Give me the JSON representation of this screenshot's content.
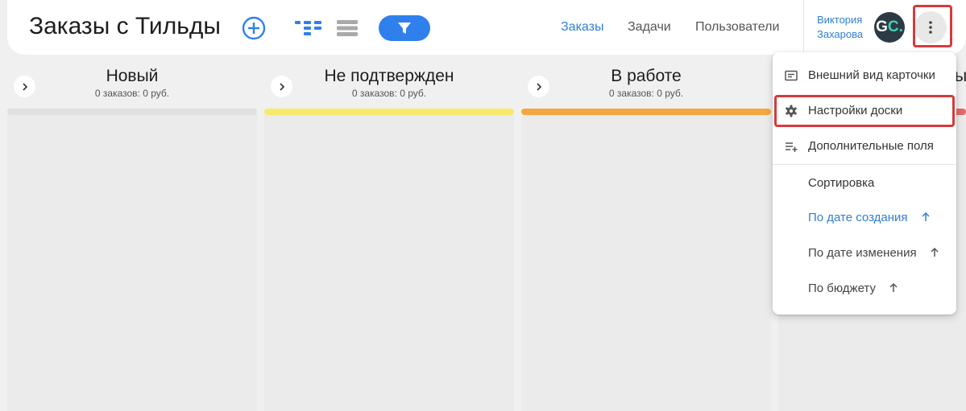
{
  "header": {
    "title": "Заказы с Тильды",
    "nav": [
      {
        "label": "Заказы",
        "active": true
      },
      {
        "label": "Задачи",
        "active": false
      },
      {
        "label": "Пользователи",
        "active": false
      }
    ],
    "user": {
      "first_name": "Виктория",
      "last_name": "Захарова",
      "avatar_initials_main": "G",
      "avatar_initials_accent": "C."
    },
    "icons": {
      "add": "plus-circle-icon",
      "kanban": "kanban-view-icon",
      "list": "list-view-icon",
      "filter": "filter-icon",
      "more": "more-vertical-icon"
    }
  },
  "columns": [
    {
      "title": "Новый",
      "summary": "0 заказов: 0 руб.",
      "color": "#e0e0e0"
    },
    {
      "title": "Не подтвержден",
      "summary": "0 заказов: 0 руб.",
      "color": "#f7e96b"
    },
    {
      "title": "В работе",
      "summary": "0 заказов: 0 руб.",
      "color": "#f4a63f"
    }
  ],
  "partial_column": {
    "title_fragment": "ы",
    "color": "#e46868"
  },
  "menu": {
    "items": [
      {
        "label": "Внешний вид карточки",
        "icon": "card-view-icon"
      },
      {
        "label": "Настройки доски",
        "icon": "gear-icon"
      },
      {
        "label": "Дополнительные поля",
        "icon": "add-fields-icon"
      }
    ],
    "sort_header": "Сортировка",
    "sort_options": [
      {
        "label": "По дате создания",
        "active": true
      },
      {
        "label": "По дате изменения",
        "active": false
      },
      {
        "label": "По бюджету",
        "active": false
      }
    ]
  },
  "colors": {
    "accent": "#2f80ed",
    "link": "#2f7fd8",
    "highlight": "#d63a3a"
  }
}
